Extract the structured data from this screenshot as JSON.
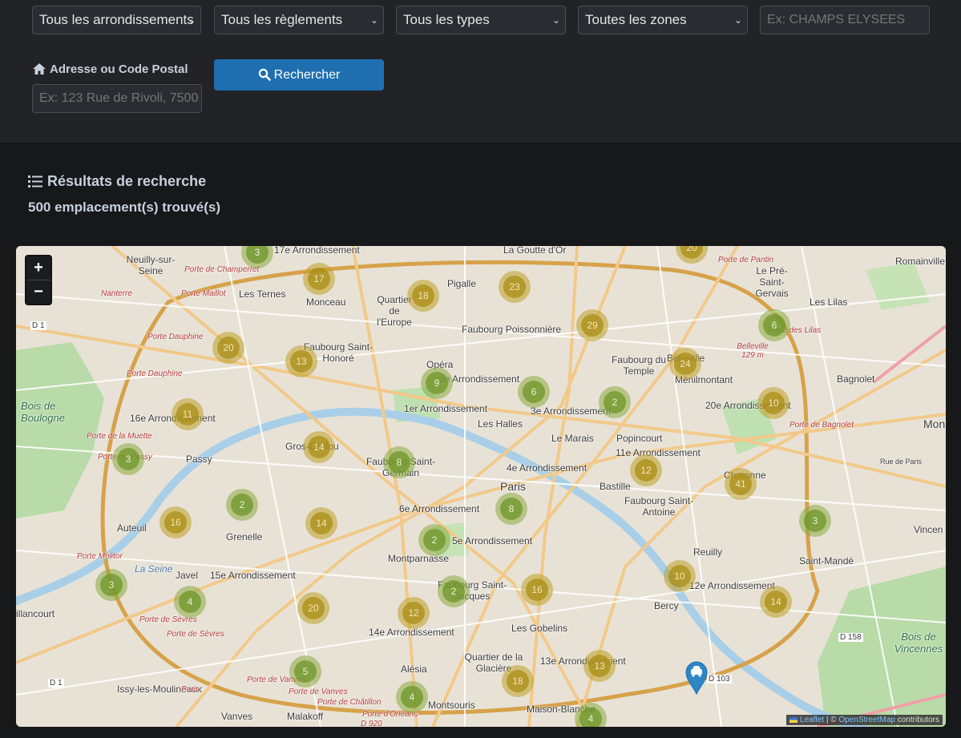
{
  "filters": {
    "arrondissement": "Tous les arrondissements",
    "reglement": "Tous les règlements",
    "type": "Tous les types",
    "zone": "Toutes les zones",
    "street_placeholder": "Ex: CHAMPS ELYSEES"
  },
  "address": {
    "label": "Adresse ou Code Postal",
    "placeholder": "Ex: 123 Rue de Rivoli, 75001",
    "search_button": "Rechercher"
  },
  "results": {
    "title": "Résultats de recherche",
    "count_text": "500 emplacement(s) trouvé(s)"
  },
  "map": {
    "zoom_in": "+",
    "zoom_out": "−",
    "attribution": {
      "leaflet": "Leaflet",
      "separator": " | © ",
      "osm": "OpenStreetMap",
      "suffix": " contributors"
    },
    "clusters": [
      {
        "n": "3",
        "s": "sm"
      },
      {
        "n": "20",
        "s": "md"
      },
      {
        "n": "17",
        "s": "md"
      },
      {
        "n": "18",
        "s": "md"
      },
      {
        "n": "23",
        "s": "md"
      },
      {
        "n": "29",
        "s": "md"
      },
      {
        "n": "6",
        "s": "sm"
      },
      {
        "n": "20",
        "s": "md"
      },
      {
        "n": "13",
        "s": "md"
      },
      {
        "n": "24",
        "s": "md"
      },
      {
        "n": "9",
        "s": "sm"
      },
      {
        "n": "6",
        "s": "sm"
      },
      {
        "n": "2",
        "s": "sm"
      },
      {
        "n": "10",
        "s": "md"
      },
      {
        "n": "11",
        "s": "md"
      },
      {
        "n": "14",
        "s": "md"
      },
      {
        "n": "8",
        "s": "sm"
      },
      {
        "n": "12",
        "s": "md"
      },
      {
        "n": "3",
        "s": "sm"
      },
      {
        "n": "41",
        "s": "md"
      },
      {
        "n": "2",
        "s": "sm"
      },
      {
        "n": "8",
        "s": "sm"
      },
      {
        "n": "16",
        "s": "md"
      },
      {
        "n": "14",
        "s": "md"
      },
      {
        "n": "2",
        "s": "sm"
      },
      {
        "n": "3",
        "s": "sm"
      },
      {
        "n": "10",
        "s": "md"
      },
      {
        "n": "3",
        "s": "sm"
      },
      {
        "n": "4",
        "s": "sm"
      },
      {
        "n": "20",
        "s": "md"
      },
      {
        "n": "2",
        "s": "sm"
      },
      {
        "n": "16",
        "s": "md"
      },
      {
        "n": "12",
        "s": "md"
      },
      {
        "n": "14",
        "s": "md"
      },
      {
        "n": "5",
        "s": "sm"
      },
      {
        "n": "13",
        "s": "md"
      },
      {
        "n": "18",
        "s": "md"
      },
      {
        "n": "4",
        "s": "sm"
      },
      {
        "n": "4",
        "s": "sm"
      }
    ],
    "labels": {
      "neuilly": "Neuilly-sur-Seine",
      "seventeenth": "17e Arrondissement",
      "goutte": "La Goutte d'Or",
      "romainville": "Romainville",
      "porte_pantin": "Porte de Pantin",
      "pre_st_gervais": "Le Pré-Saint-Gervais",
      "porte_champerret": "Porte de Champerret",
      "pigalle": "Pigalle",
      "ternes": "Les Ternes",
      "monceau": "Monceau",
      "quartier_europe": "Quartier de l'Europe",
      "porte_maillot": "Porte Maillot",
      "lilas": "Les Lilas",
      "nanterre": "Nanterre",
      "faubourg_poissonniere": "Faubourg Poissonnière",
      "d1": "D 1",
      "porte_dauphine": "Porte Dauphine",
      "faubourg_st_honore": "Faubourg Saint-Honoré",
      "belleville": "Belleville",
      "faubourg_du_temple": "Faubourg du Temple",
      "porte_lilas": "Porte des Lilas",
      "belleville_alt": "Belleville 129 m",
      "porte_dauphine2": "Porte Dauphine",
      "menilmontant": "Ménilmontant",
      "bagnolet": "Bagnolet",
      "opera": "Opéra",
      "second": "2e Arrondissement",
      "bois_boulogne": "Bois de Boulogne",
      "sixteenth": "16e Arrondissement",
      "first": "1er Arrondissement",
      "third": "3e Arrondissement",
      "twentieth": "20e Arrondissement",
      "mon": "Mon",
      "porte_muette": "Porte de la Muette",
      "halles": "Les Halles",
      "porte_bagnolet": "Porte de Bagnolet",
      "marais": "Le Marais",
      "popincourt": "Popincourt",
      "gros_caillou": "Gros-Caillou",
      "passy": "Passy",
      "porte_passy": "Porte de Passy",
      "eleventh": "11e Arrondissement",
      "faubourg_st_germain": "Faubourg Saint-Germain",
      "fourth": "4e Arrondissement",
      "rue_paris": "Rue de Paris",
      "charonne": "Charonne",
      "paris": "Paris",
      "bastille": "Bastille",
      "sixth": "6e Arrondissement",
      "faubourg_st_antoine": "Faubourg Saint-Antoine",
      "auteuil": "Auteuil",
      "vincennes_cut": "Vincen",
      "grenelle": "Grenelle",
      "fifth": "5e Arrondissement",
      "reuilly": "Reuilly",
      "montparnasse": "Montparnasse",
      "porte_molitor": "Porte Molitor",
      "saint_mande": "Saint-Mandé",
      "la_seine": "La Seine",
      "javel": "Javel",
      "fifteenth": "15e Arrondissement",
      "twelfth": "12e Arrondissement",
      "faubourg_st_jacques": "Faubourg Saint-Jacques",
      "bercy": "Bercy",
      "billancourt": "illancourt",
      "porte_sevres": "Porte de Sèvres",
      "porte_sevres2": "Porte de Sèvres",
      "gobelins": "Les Gobelins",
      "fourteenth": "14e Arrondissement",
      "d158": "D 158",
      "bois_vincennes": "Bois de Vincennes",
      "quartier_glaciere": "Quartier de la Glacière",
      "thirteenth": "13e Arrondissement",
      "alesia": "Alésia",
      "d103": "D 103",
      "porte_vanves": "Porte de Vanves",
      "porte_vanves2": "Porte de Vanves",
      "issy": "Issy-les-Moulineaux",
      "porte_chatillon": "Porte de Châtillon",
      "montsouris": "Montsouris",
      "maison_blanche": "Maison-Blanche",
      "vanves": "Vanves",
      "malakoff": "Malakoff",
      "porte_orleans": "Porte d'Orléans",
      "d920": "D 920",
      "d1b": "D 1",
      "paris_b": "Paris"
    }
  }
}
